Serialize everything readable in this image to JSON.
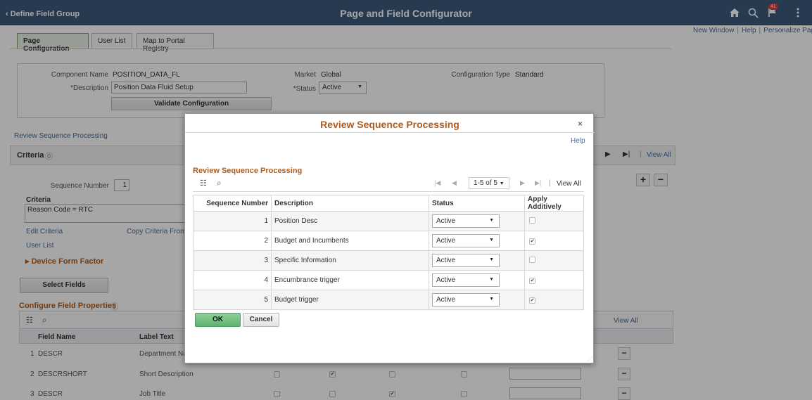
{
  "header": {
    "back_label": "Define Field Group",
    "title": "Page and Field Configurator",
    "notification_count": "41",
    "links": [
      "New Window",
      "Help",
      "Personalize Pag"
    ]
  },
  "tabs": [
    "Page Configuration",
    "User List",
    "Map to Portal Registry"
  ],
  "config": {
    "component_name_label": "Component Name",
    "component_name": "POSITION_DATA_FL",
    "description_label": "*Description",
    "description": "Position Data Fluid Setup",
    "validate_button": "Validate Configuration",
    "market_label": "Market",
    "market": "Global",
    "status_label": "*Status",
    "status": "Active",
    "config_type_label": "Configuration Type",
    "config_type": "Standard"
  },
  "review_link": "Review Sequence Processing",
  "criteria": {
    "title": "Criteria",
    "view_all": "View All",
    "sequence_number_label": "Sequence Number",
    "sequence_number": "1",
    "criteria_label": "Criteria",
    "criteria_value": "Reason Code = RTC",
    "edit_criteria": "Edit Criteria",
    "copy_criteria": "Copy Criteria From",
    "user_list": "User List",
    "device_form_factor": "Device Form Factor",
    "select_fields_button": "Select Fields"
  },
  "field_props": {
    "title": "Configure Field Properties",
    "view_all": "View All",
    "columns": [
      "Field Name",
      "Label Text"
    ],
    "rows": [
      {
        "num": "1",
        "field": "DESCR",
        "label": "Department Nar"
      },
      {
        "num": "2",
        "field": "DESCRSHORT",
        "label": "Short Description"
      },
      {
        "num": "3",
        "field": "DESCR",
        "label": "Job Title"
      }
    ]
  },
  "modal": {
    "title": "Review Sequence Processing",
    "close": "×",
    "help": "Help",
    "section_title": "Review Sequence Processing",
    "pager": "1-5 of 5",
    "view_all": "View All",
    "columns": [
      "Sequence Number",
      "Description",
      "Status",
      "Apply Additively"
    ],
    "rows": [
      {
        "seq": "1",
        "desc": "Position Desc",
        "status": "Active",
        "additive": false
      },
      {
        "seq": "2",
        "desc": "Budget and Incumbents",
        "status": "Active",
        "additive": true
      },
      {
        "seq": "3",
        "desc": "Specific Information",
        "status": "Active",
        "additive": false
      },
      {
        "seq": "4",
        "desc": "Encumbrance trigger",
        "status": "Active",
        "additive": true
      },
      {
        "seq": "5",
        "desc": "Budget trigger",
        "status": "Active",
        "additive": true
      }
    ],
    "ok": "OK",
    "cancel": "Cancel"
  }
}
